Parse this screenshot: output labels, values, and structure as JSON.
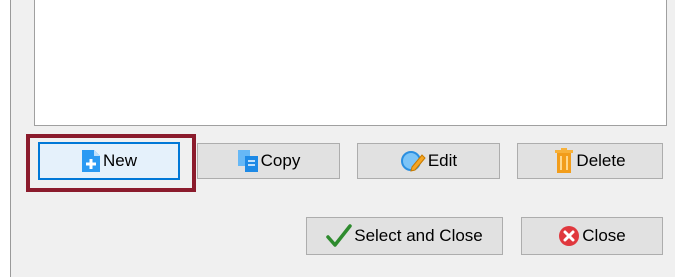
{
  "buttons": {
    "new": "New",
    "copy": "Copy",
    "edit": "Edit",
    "delete": "Delete",
    "select_and_close": "Select and Close",
    "close": "Close"
  },
  "icons": {
    "new": "document-add-icon",
    "copy": "copy-icon",
    "edit": "edit-icon",
    "delete": "trash-icon",
    "select_and_close": "checkmark-icon",
    "close": "close-circle-icon"
  },
  "colors": {
    "focus_border": "#0078d7",
    "highlight_frame": "#8b1b2c",
    "checkmark": "#2e8b2e",
    "close_icon": "#e0383e"
  }
}
